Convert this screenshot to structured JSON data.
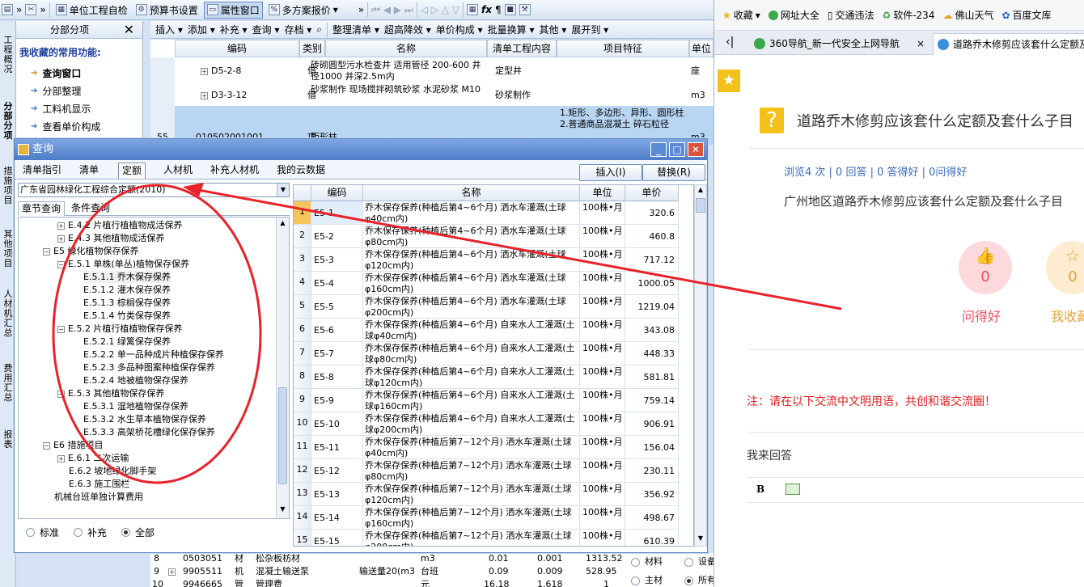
{
  "app": {
    "toolbar1": [
      "单位工程自检",
      "预算书设置",
      "属性窗口",
      "多方案报价"
    ],
    "toolbar2": [
      "插入",
      "添加",
      "补充",
      "查询",
      "存档",
      "整理清单",
      "超高降效",
      "单价构成",
      "批量换算",
      "其他",
      "展开到"
    ],
    "vtabs": [
      "工程概况",
      "分部分项",
      "措施项目",
      "其他项目",
      "人材机汇总",
      "费用汇总",
      "报表"
    ],
    "nav": {
      "title": "分部分项",
      "fav_title": "我收藏的常用功能:",
      "items": [
        "查询窗口",
        "分部整理",
        "工料机显示",
        "查看单价构成"
      ]
    },
    "grid": {
      "headers": [
        "编码",
        "类别",
        "名称",
        "清单工程内容",
        "项目特征",
        "单位"
      ],
      "rows": [
        {
          "code": "D5-2-8",
          "type": "借",
          "name": "砖砌圆型污水检查井 适用管径 200-600 井径1000 井深2.5m内",
          "content": "定型井",
          "feature": "",
          "unit": "座"
        },
        {
          "code": "D3-3-12",
          "type": "借",
          "name": "砂浆制作 现场搅拌砌筑砂浆 水泥砂浆 M10",
          "content": "砂浆制作",
          "feature": "",
          "unit": "m3"
        },
        {
          "no": "55",
          "code": "010502001001",
          "type": "项",
          "name": "矩形柱",
          "content": "",
          "feature": "1.矩形、多边形、异形、圆形柱 2.普通商品混凝土 碎石粒径",
          "unit": "m3"
        }
      ]
    },
    "bottom_rows": [
      {
        "no": "8",
        "code": "0503051",
        "type": "材",
        "name": "松杂板枋材",
        "unit": "m3",
        "q1": "0.01",
        "q2": "0.001",
        "price": "1313.52"
      },
      {
        "no": "9",
        "code": "9905511",
        "type": "机",
        "name": "混凝土输送泵",
        "spec": "输送量20(m3",
        "unit": "台班",
        "q1": "0.09",
        "q2": "0.009",
        "price": "528.95"
      },
      {
        "no": "10",
        "code": "9946665",
        "type": "管",
        "name": "管理费",
        "unit": "元",
        "q1": "16.18",
        "q2": "1.618",
        "price": "1"
      }
    ],
    "bottom_radios": [
      "材料",
      "设备",
      "主材",
      "所有"
    ]
  },
  "dialog": {
    "title": "查询",
    "tabs": [
      "清单指引",
      "清单",
      "定额",
      "人材机",
      "补充人材机",
      "我的云数据"
    ],
    "active_tab": "定额",
    "buttons": [
      "插入(I)",
      "替换(R)"
    ],
    "combo": "广东省园林绿化工程综合定额(2010)",
    "tree_tabs": [
      "章节查询",
      "条件查询"
    ],
    "tree": [
      {
        "t": "E.4.2 片植行植植物成活保养",
        "lvl": 2,
        "pm": "+"
      },
      {
        "t": "E.4.3 其他植物成活保养",
        "lvl": 2,
        "pm": "+"
      },
      {
        "t": "E5 绿化植物保存保养",
        "lvl": 0,
        "pm": "-"
      },
      {
        "t": "E.5.1 单株(单丛)植物保存保养",
        "lvl": 1,
        "pm": "-"
      },
      {
        "t": "E.5.1.1 乔木保存保养",
        "lvl": 2,
        "sel": true
      },
      {
        "t": "E.5.1.2 灌木保存保养",
        "lvl": 2
      },
      {
        "t": "E.5.1.3 棕榈保存保养",
        "lvl": 2
      },
      {
        "t": "E.5.1.4 竹类保存保养",
        "lvl": 2
      },
      {
        "t": "E.5.2 片植行植植物保存保养",
        "lvl": 1,
        "pm": "-"
      },
      {
        "t": "E.5.2.1 绿篱保存保养",
        "lvl": 2
      },
      {
        "t": "E.5.2.2 单一品种成片种植保存保养",
        "lvl": 2
      },
      {
        "t": "E.5.2.3 多品种图案种植保存保养",
        "lvl": 2
      },
      {
        "t": "E.5.2.4 地被植物保存保养",
        "lvl": 2
      },
      {
        "t": "E.5.3 其他植物保存保养",
        "lvl": 1,
        "pm": "-"
      },
      {
        "t": "E.5.3.1 湿地植物保存保养",
        "lvl": 2
      },
      {
        "t": "E.5.3.2 水生草本植物保存保养",
        "lvl": 2
      },
      {
        "t": "E.5.3.3 高架桥花槽绿化保存保养",
        "lvl": 2
      },
      {
        "t": "E6 措施项目",
        "lvl": 0,
        "pm": "-"
      },
      {
        "t": "E.6.1 二次运输",
        "lvl": 1,
        "pm": "+"
      },
      {
        "t": "E.6.2 坡地绿化脚手架",
        "lvl": 1
      },
      {
        "t": "E.6.3 施工围栏",
        "lvl": 1
      },
      {
        "t": "机械台班单独计算费用",
        "lvl": 0
      }
    ],
    "radios": [
      "标准",
      "补充",
      "全部"
    ],
    "radio_selected": "全部",
    "grid_headers": [
      "编码",
      "名称",
      "单位",
      "单价"
    ],
    "rows": [
      {
        "no": "1",
        "code": "E5-1",
        "name": "乔木保存保养(种植后第4~6个月) 洒水车灌溉(土球φ40cm内)",
        "unit": "100株•月",
        "price": "320.6"
      },
      {
        "no": "2",
        "code": "E5-2",
        "name": "乔木保存保养(种植后第4~6个月) 洒水车灌溉(土球φ80cm内)",
        "unit": "100株•月",
        "price": "460.8"
      },
      {
        "no": "3",
        "code": "E5-3",
        "name": "乔木保存保养(种植后第4~6个月) 洒水车灌溉(土球φ120cm内)",
        "unit": "100株•月",
        "price": "717.12"
      },
      {
        "no": "4",
        "code": "E5-4",
        "name": "乔木保存保养(种植后第4~6个月) 洒水车灌溉(土球φ160cm内)",
        "unit": "100株•月",
        "price": "1000.05"
      },
      {
        "no": "5",
        "code": "E5-5",
        "name": "乔木保存保养(种植后第4~6个月) 洒水车灌溉(土球φ200cm内)",
        "unit": "100株•月",
        "price": "1219.04"
      },
      {
        "no": "6",
        "code": "E5-6",
        "name": "乔木保存保养(种植后第4~6个月) 自来水人工灌溉(土球φ40cm内)",
        "unit": "100株•月",
        "price": "343.08"
      },
      {
        "no": "7",
        "code": "E5-7",
        "name": "乔木保存保养(种植后第4~6个月) 自来水人工灌溉(土球φ80cm内)",
        "unit": "100株•月",
        "price": "448.33"
      },
      {
        "no": "8",
        "code": "E5-8",
        "name": "乔木保存保养(种植后第4~6个月) 自来水人工灌溉(土球φ120cm内)",
        "unit": "100株•月",
        "price": "581.81"
      },
      {
        "no": "9",
        "code": "E5-9",
        "name": "乔木保存保养(种植后第4~6个月) 自来水人工灌溉(土球φ160cm内)",
        "unit": "100株•月",
        "price": "759.14"
      },
      {
        "no": "10",
        "code": "E5-10",
        "name": "乔木保存保养(种植后第4~6个月) 自来水人工灌溉(土球φ200cm内)",
        "unit": "100株•月",
        "price": "906.91"
      },
      {
        "no": "11",
        "code": "E5-11",
        "name": "乔木保存保养(种植后第7~12个月) 洒水车灌溉(土球φ40cm内)",
        "unit": "100株•月",
        "price": "156.04"
      },
      {
        "no": "12",
        "code": "E5-12",
        "name": "乔木保存保养(种植后第7~12个月) 洒水车灌溉(土球φ80cm内)",
        "unit": "100株•月",
        "price": "230.11"
      },
      {
        "no": "13",
        "code": "E5-13",
        "name": "乔木保存保养(种植后第7~12个月) 洒水车灌溉(土球φ120cm内)",
        "unit": "100株•月",
        "price": "356.92"
      },
      {
        "no": "14",
        "code": "E5-14",
        "name": "乔木保存保养(种植后第7~12个月) 洒水车灌溉(土球φ160cm内)",
        "unit": "100株•月",
        "price": "498.67"
      },
      {
        "no": "15",
        "code": "E5-15",
        "name": "乔木保存保养(种植后第7~12个月) 洒水车灌溉(土球φ200cm内)",
        "unit": "100株•月",
        "price": "610.39"
      }
    ]
  },
  "browser": {
    "bookmarks": [
      "收藏",
      "网址大全",
      "交通违法",
      "软件-234",
      "佛山天气",
      "百度文库"
    ],
    "tabs": [
      "360导航_新一代安全上网导航",
      "道路乔木修剪应该套什么定额及套什么子目"
    ],
    "question_title": "道路乔木修剪应该套什么定额及套什么子目",
    "meta": "浏览4 次 | 0 回答 | 0 答得好 | 0问得好",
    "question_desc": "广州地区道路乔木修剪应该套什么定额及套什么子目",
    "votes": [
      {
        "label": "问得好",
        "count": "0"
      },
      {
        "label": "我收藏",
        "count": "0"
      }
    ],
    "notice": "注：请在以下交流中文明用语，共创和谐交流圈！",
    "answer_label": "我来回答",
    "editor": [
      "B"
    ],
    "colors": {
      "accent": "#f4c01a",
      "link": "#3a6bc0",
      "notice": "#e02020",
      "annotation": "#e8222a"
    }
  }
}
